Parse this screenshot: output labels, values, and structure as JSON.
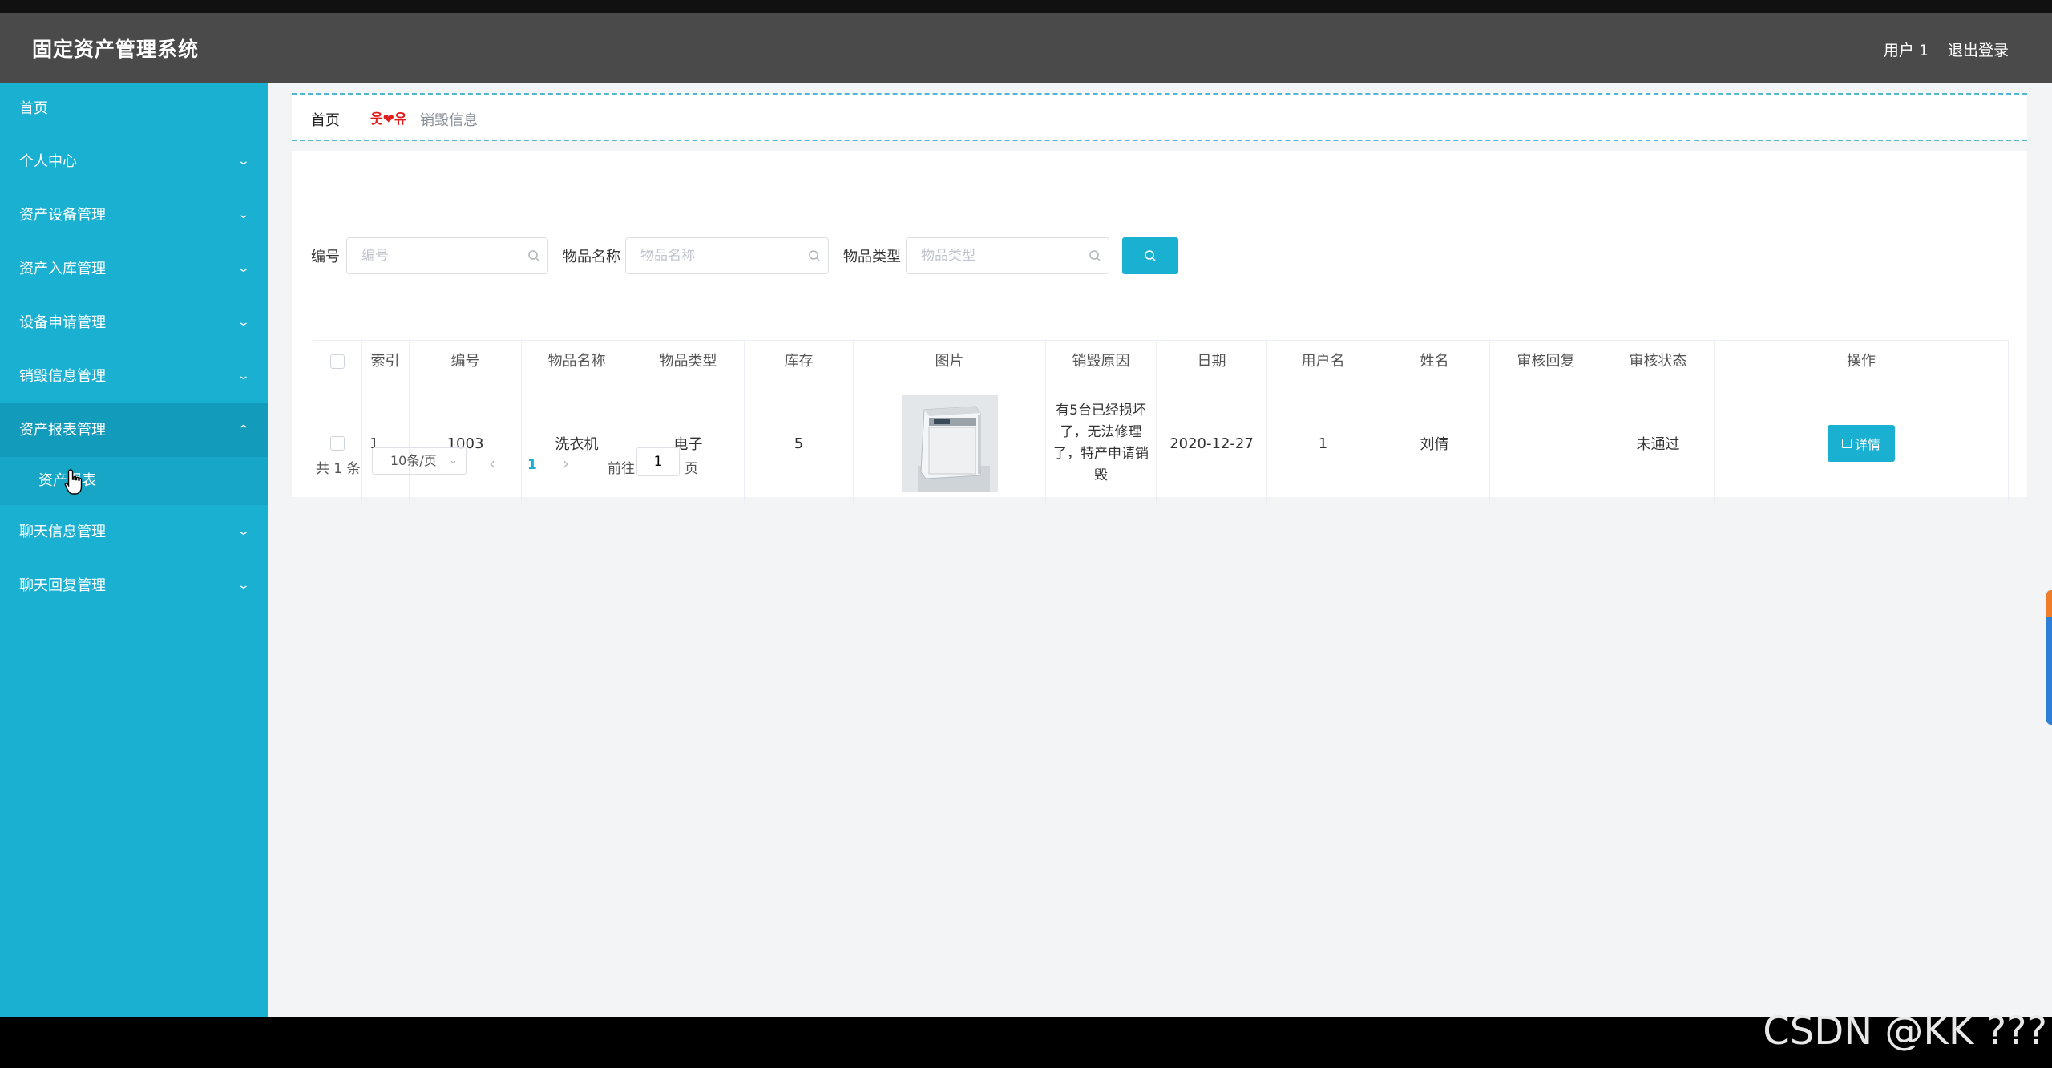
{
  "header": {
    "title": "固定资产管理系统",
    "user": "用户 1",
    "logout": "退出登录"
  },
  "sidebar": {
    "items": [
      {
        "label": "首页"
      },
      {
        "label": "个人中心"
      },
      {
        "label": "资产设备管理"
      },
      {
        "label": "资产入库管理"
      },
      {
        "label": "设备申请管理"
      },
      {
        "label": "销毁信息管理"
      },
      {
        "label": "资产报表管理"
      },
      {
        "label": "聊天信息管理"
      },
      {
        "label": "聊天回复管理"
      }
    ],
    "submenu": {
      "label": "资产报表"
    }
  },
  "breadcrumb": {
    "home": "首页",
    "separator": "웃❤유",
    "current": "销毁信息"
  },
  "filters": {
    "code_label": "编号",
    "code_placeholder": "编号",
    "name_label": "物品名称",
    "name_placeholder": "物品名称",
    "type_label": "物品类型",
    "type_placeholder": "物品类型"
  },
  "table": {
    "columns": [
      "索引",
      "编号",
      "物品名称",
      "物品类型",
      "库存",
      "图片",
      "销毁原因",
      "日期",
      "用户名",
      "姓名",
      "审核回复",
      "审核状态",
      "操作"
    ],
    "rows": [
      {
        "index": "1",
        "code": "1003",
        "name": "洗衣机",
        "type": "电子",
        "stock": "5",
        "reason": "有5台已经损坏了，无法修理了，特产申请销毁",
        "date": "2020-12-27",
        "username": "1",
        "realname": "刘倩",
        "reply": "",
        "status": "未通过",
        "action": "详情"
      }
    ]
  },
  "pager": {
    "total": "共 1 条",
    "pagesize": "10条/页",
    "current_page": "1",
    "goto_prefix": "前往",
    "goto_value": "1",
    "goto_suffix": "页"
  },
  "watermark": "CSDN @KK ???",
  "colors": {
    "sidebar": "#1ab0d2",
    "header": "#4a4a4a",
    "accent": "#1ab0d2"
  }
}
